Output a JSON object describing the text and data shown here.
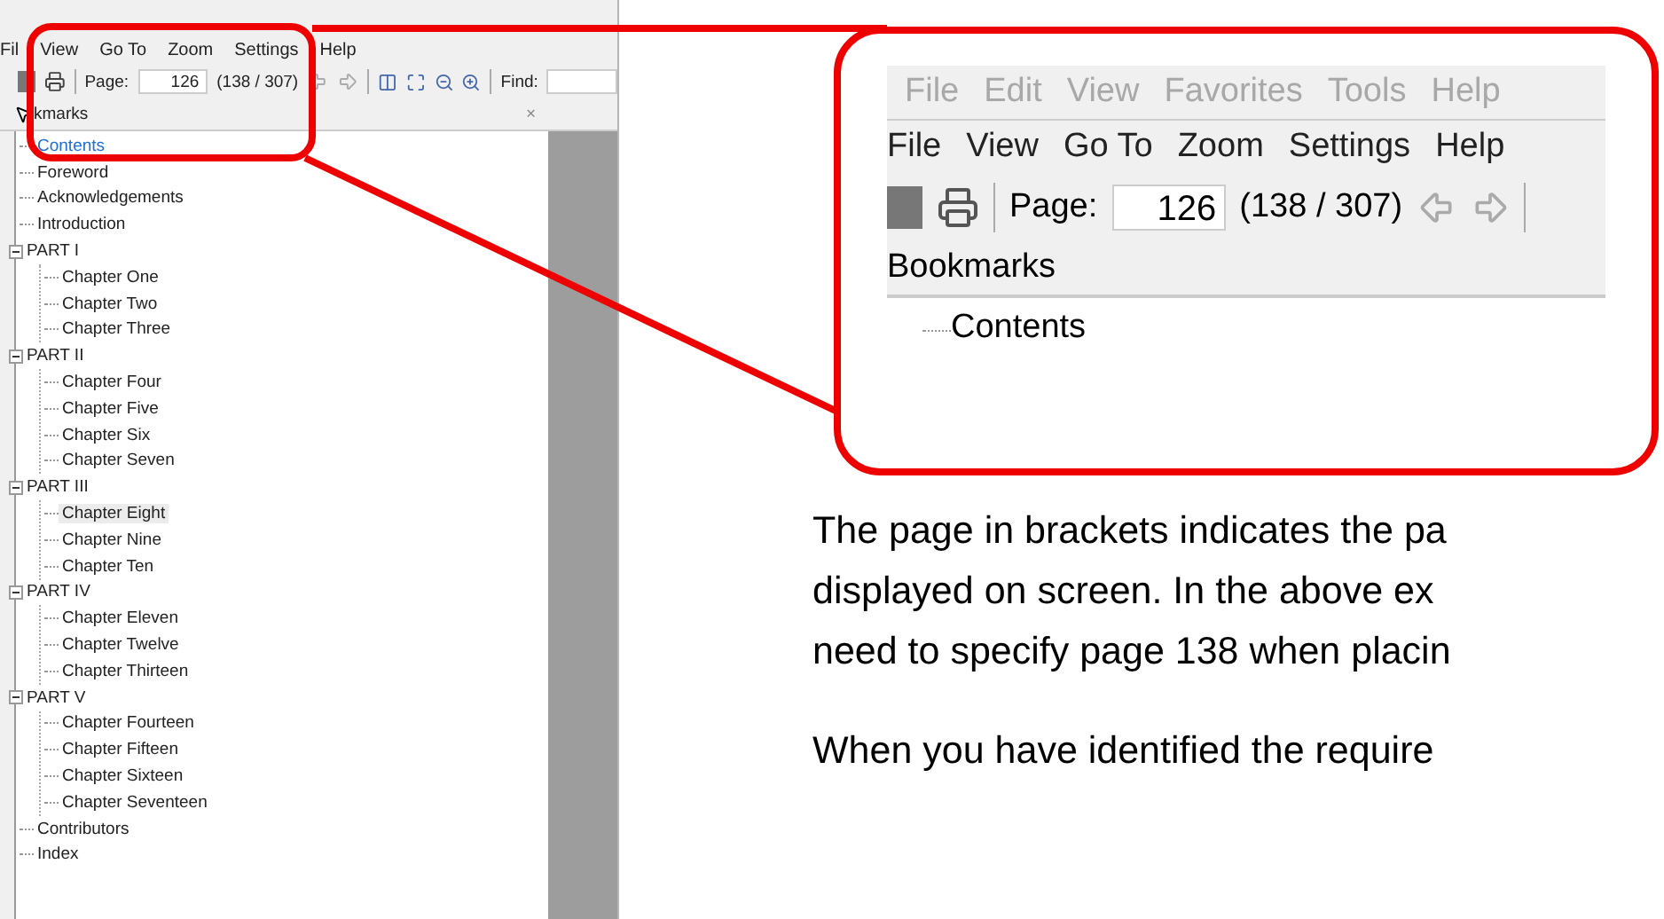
{
  "app_window": {
    "menu": [
      "Fil",
      "View",
      "Go To",
      "Zoom",
      "Settings",
      "Help"
    ],
    "toolbar": {
      "page_label": "Page:",
      "page_value": "126",
      "page_count": "(138 / 307)",
      "find_label": "Find:"
    },
    "bookmarks_panel": {
      "title": "kmarks",
      "close": "×",
      "tree": [
        {
          "label": "Contents",
          "selected": true
        },
        {
          "label": "Foreword",
          "selected": false
        },
        {
          "label": "Acknowledgements",
          "selected": false
        },
        {
          "label": "Introduction",
          "selected": false
        },
        {
          "label": "PART I",
          "selected": false,
          "expanded": true,
          "children": [
            {
              "label": "Chapter One",
              "selected": false
            },
            {
              "label": "Chapter Two",
              "selected": false
            },
            {
              "label": "Chapter Three",
              "selected": false
            }
          ]
        },
        {
          "label": "PART II",
          "selected": false,
          "expanded": true,
          "children": [
            {
              "label": "Chapter Four",
              "selected": false
            },
            {
              "label": "Chapter Five",
              "selected": false
            },
            {
              "label": "Chapter Six",
              "selected": false
            },
            {
              "label": "Chapter Seven",
              "selected": false
            }
          ]
        },
        {
          "label": "PART III",
          "selected": false,
          "expanded": true,
          "children": [
            {
              "label": "Chapter Eight",
              "selected": false,
              "hovered": true
            },
            {
              "label": "Chapter Nine",
              "selected": false
            },
            {
              "label": "Chapter Ten",
              "selected": false
            }
          ]
        },
        {
          "label": "PART IV",
          "selected": false,
          "expanded": true,
          "children": [
            {
              "label": "Chapter Eleven",
              "selected": false
            },
            {
              "label": "Chapter Twelve",
              "selected": false
            },
            {
              "label": "Chapter Thirteen",
              "selected": false
            }
          ]
        },
        {
          "label": "PART V",
          "selected": false,
          "expanded": true,
          "children": [
            {
              "label": "Chapter Fourteen",
              "selected": false
            },
            {
              "label": "Chapter Fifteen",
              "selected": false
            },
            {
              "label": "Chapter Sixteen",
              "selected": false
            },
            {
              "label": "Chapter Seventeen",
              "selected": false
            }
          ]
        },
        {
          "label": "Contributors",
          "selected": false
        },
        {
          "label": "Index",
          "selected": false
        }
      ]
    }
  },
  "callout": {
    "faded_menu": [
      "File",
      "Edit",
      "View",
      "Favorites",
      "Tools",
      "Help"
    ],
    "menu": [
      "File",
      "View",
      "Go To",
      "Zoom",
      "Settings",
      "Help"
    ],
    "page_label": "Page:",
    "page_value": "126",
    "page_count": "(138 / 307)",
    "bookmarks_title": "Bookmarks",
    "tree_item": "Contents"
  },
  "text_lines": [
    "The page in brackets indicates the pa",
    "displayed on screen.  In the above ex",
    "need to specify page 138 when placin"
  ],
  "text_lines_2": [
    "When you have identified the require"
  ]
}
